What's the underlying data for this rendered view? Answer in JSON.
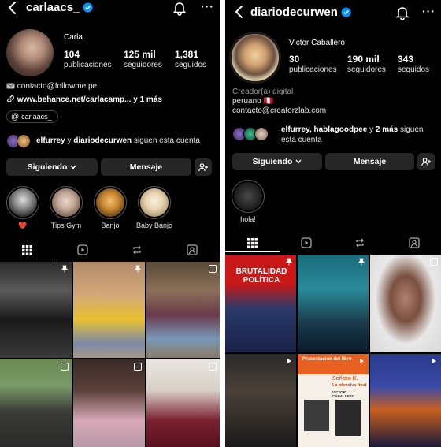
{
  "left": {
    "username": "carlaacs_",
    "name": "Carla",
    "stats": [
      {
        "value": "104",
        "label": "publicaciones"
      },
      {
        "value": "125 mil",
        "label": "seguidores"
      },
      {
        "value": "1,381",
        "label": "seguidos"
      }
    ],
    "bio_email": "contacto@followme.pe",
    "bio_link": "www.behance.net/carlacamp...",
    "bio_link_more": "y 1 más",
    "threads_chip": "carlaacs_",
    "followed_by_names": "elfurrey",
    "followed_by_mid": " y ",
    "followed_by_names2": "diariodecurwen",
    "followed_by_suffix": " siguen esta cuenta",
    "following_button": "Siguiendo",
    "message_button": "Mensaje",
    "highlights": [
      {
        "label": "❤️"
      },
      {
        "label": "Tips Gym"
      },
      {
        "label": "Banjo"
      },
      {
        "label": "Baby Banjo"
      }
    ]
  },
  "right": {
    "username": "diariodecurwen",
    "name": "Victor Caballero",
    "stats": [
      {
        "value": "30",
        "label": "publicaciones"
      },
      {
        "value": "190 mil",
        "label": "seguidores"
      },
      {
        "value": "343",
        "label": "seguidos"
      }
    ],
    "category": "Creador(a) digital",
    "bio_line1": "peruano 🇵🇪",
    "bio_line2": "contacto@creatorzlab.com",
    "followed_by_names": "elfurrey, hablagoodpee",
    "followed_by_mid": " y ",
    "followed_by_names2": "2 más",
    "followed_by_suffix": " siguen esta cuenta",
    "following_button": "Siguiendo",
    "message_button": "Mensaje",
    "highlights": [
      {
        "label": "hola!"
      }
    ],
    "post_texts": {
      "brutalidad": "BRUTALIDAD POLÍTICA",
      "presentacion": "Presentación del libro",
      "senora_k": "Señora K.",
      "senora_k_sub": "La ofensiva final",
      "author": "VICTOR CABALLERO"
    }
  },
  "colors": {
    "background": "#000000",
    "button": "#262626",
    "verified": "#0095f6",
    "text": "#f5f5f5",
    "muted": "#9a9a9a"
  },
  "icons": [
    "back-arrow-icon",
    "verified-badge-icon",
    "bell-icon",
    "more-icon",
    "mail-icon",
    "link-icon",
    "threads-icon",
    "chevron-down-icon",
    "add-person-icon",
    "grid-icon",
    "reels-icon",
    "repost-icon",
    "tagged-icon",
    "pin-icon",
    "multi-post-icon"
  ]
}
